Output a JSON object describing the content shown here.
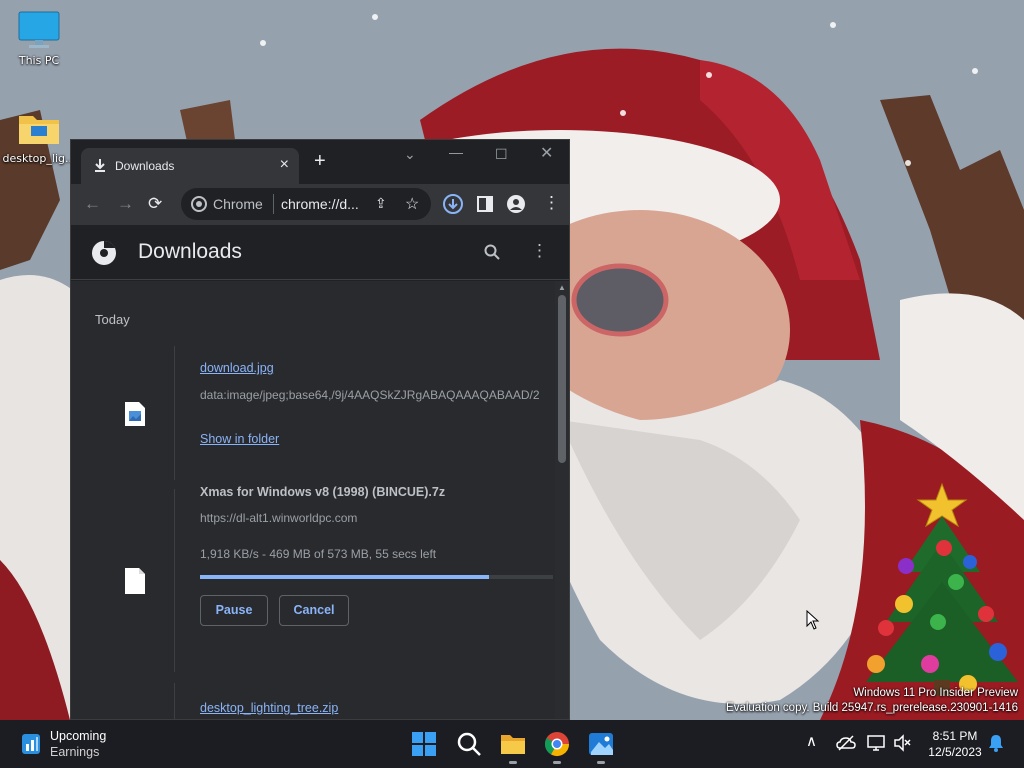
{
  "desktop": {
    "icons": [
      {
        "label": "This PC",
        "icon": "monitor-icon"
      },
      {
        "label": "desktop_lig...",
        "icon": "folder-icon"
      }
    ],
    "watermark": {
      "line1": "Windows 11 Pro Insider Preview",
      "line2": "Evaluation copy. Build 25947.rs_prerelease.230901-1416"
    }
  },
  "browser": {
    "tab_title": "Downloads",
    "omnibox_site": "Chrome",
    "omnibox_url": "chrome://d...",
    "page_title": "Downloads",
    "date_heading": "Today",
    "downloads": [
      {
        "filename": "download.jpg",
        "source": "data:image/jpeg;base64,/9j/4AAQSkZJRgABAQAAAQABAAD/2",
        "action": "Show in folder",
        "file_icon": "image-file-icon"
      },
      {
        "filename": "Xmas for Windows v8 (1998) (BINCUE).7z",
        "source": "https://dl-alt1.winworldpc.com",
        "status": "1,918 KB/s - 469 MB of 573 MB, 55 secs left",
        "progress": 0.82,
        "pause_label": "Pause",
        "cancel_label": "Cancel",
        "file_icon": "file-icon"
      },
      {
        "filename": "desktop_lighting_tree.zip"
      }
    ]
  },
  "taskbar": {
    "widget_title": "Upcoming",
    "widget_subtitle": "Earnings",
    "apps": [
      "start-icon",
      "search-icon",
      "file-explorer-icon",
      "chrome-icon",
      "photos-icon"
    ],
    "time": "8:51 PM",
    "date": "12/5/2023"
  },
  "colors": {
    "accent": "#8ab4f8",
    "window_bg": "#202124",
    "content_bg": "#292a2d",
    "taskbar_bg": "#1c1d22"
  }
}
